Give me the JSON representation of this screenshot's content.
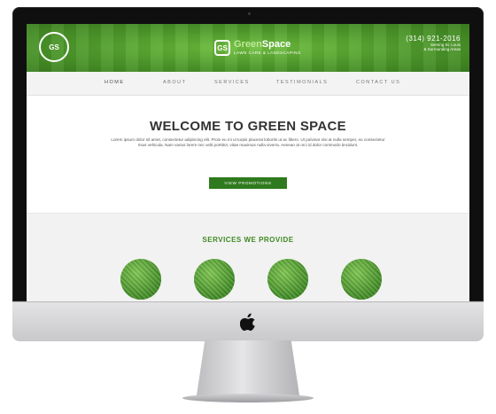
{
  "site": {
    "badge_text": "GS",
    "brand": {
      "mark": "GS",
      "name_part1": "Green",
      "name_part2": "Space",
      "subtitle": "LAWN CARE & LANDSCAPING"
    },
    "contact": {
      "phone": "(314) 921-2016",
      "line1": "Serving St. Louis",
      "line2": "& Surrounding Areas"
    },
    "nav": [
      {
        "label": "HOME"
      },
      {
        "label": "ABOUT"
      },
      {
        "label": "SERVICES"
      },
      {
        "label": "TESTIMONIALS"
      },
      {
        "label": "CONTACT US"
      }
    ],
    "hero": {
      "title": "WELCOME TO GREEN SPACE",
      "body": "Lorem ipsum dolor sit amet, consectetur adipiscing elit. Proin eu mi ut turpis placerat lobortis ut ac libero. Ut pulvinar nisi at nulla semper, eu consectetur risus vehicula. Nam varius lorem nec velit porttitor, vitae maximus nulla viverra. Aenean at orci id dolor commodo tincidunt.",
      "cta_label": "VIEW PROMOTIONS"
    },
    "services": {
      "title": "SERVICES WE PROVIDE",
      "items": [
        {
          "name": "service-1"
        },
        {
          "name": "service-2"
        },
        {
          "name": "service-3"
        },
        {
          "name": "service-4"
        }
      ]
    }
  },
  "colors": {
    "header_green": "#4e9a2b",
    "cta_green": "#2f7a1e",
    "services_title": "#3f8a24"
  },
  "device": {
    "logo_icon": "apple-logo-icon"
  }
}
